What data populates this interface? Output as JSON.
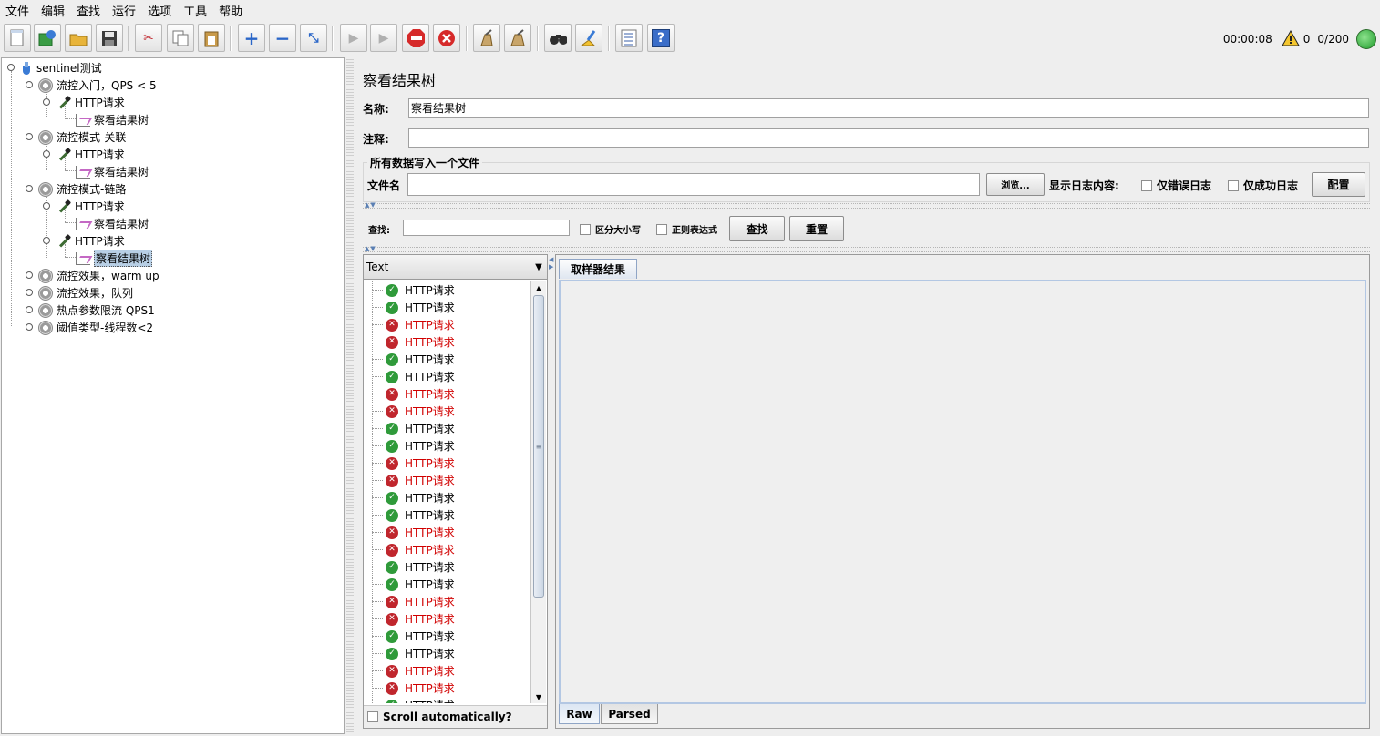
{
  "menu": [
    "文件",
    "编辑",
    "查找",
    "运行",
    "选项",
    "工具",
    "帮助"
  ],
  "toolbar_icons": [
    "new-icon",
    "templates-icon",
    "open-icon",
    "save-icon",
    "cut-icon",
    "copy-icon",
    "paste-icon",
    "expand-icon",
    "collapse-icon",
    "toggle-icon",
    "start-icon",
    "start-no-pause-icon",
    "stop-icon",
    "shutdown-icon",
    "clear-icon",
    "clear-all-icon",
    "search-icon",
    "reset-search-icon",
    "function-helper-icon",
    "help-icon"
  ],
  "status": {
    "timer": "00:00:08",
    "warnings": "0",
    "threads": "0/200"
  },
  "tree": {
    "root": "sentinel测试",
    "groups": [
      {
        "label": "流控入门，QPS < 5",
        "http": "HTTP请求",
        "listener": "察看结果树"
      },
      {
        "label": "流控模式-关联",
        "http": "HTTP请求",
        "listener": "察看结果树"
      },
      {
        "label": "流控模式-链路",
        "http": "HTTP请求",
        "listener": "察看结果树",
        "http2": "HTTP请求",
        "listener2": "察看结果树"
      },
      {
        "label": "流控效果，warm up"
      },
      {
        "label": "流控效果，队列"
      },
      {
        "label": "热点参数限流 QPS1"
      },
      {
        "label": "阈值类型-线程数<2"
      }
    ]
  },
  "panel": {
    "title": "察看结果树",
    "name_label": "名称:",
    "name_value": "察看结果树",
    "comment_label": "注释:",
    "comment_value": "",
    "file_group": "所有数据写入一个文件",
    "filename_label": "文件名",
    "filename_value": "",
    "browse": "浏览...",
    "log_label": "显示日志内容:",
    "errors_only": "仅错误日志",
    "success_only": "仅成功日志",
    "configure": "配置",
    "search_label": "查找:",
    "search_value": "",
    "case_sensitive": "区分大小写",
    "regex": "正则表达式",
    "find": "查找",
    "reset": "重置"
  },
  "renderer": "Text",
  "scroll_auto": "Scroll automatically?",
  "samples": [
    {
      "label": "HTTP请求",
      "ok": true
    },
    {
      "label": "HTTP请求",
      "ok": true
    },
    {
      "label": "HTTP请求",
      "ok": false
    },
    {
      "label": "HTTP请求",
      "ok": false
    },
    {
      "label": "HTTP请求",
      "ok": true
    },
    {
      "label": "HTTP请求",
      "ok": true
    },
    {
      "label": "HTTP请求",
      "ok": false
    },
    {
      "label": "HTTP请求",
      "ok": false
    },
    {
      "label": "HTTP请求",
      "ok": true
    },
    {
      "label": "HTTP请求",
      "ok": true
    },
    {
      "label": "HTTP请求",
      "ok": false
    },
    {
      "label": "HTTP请求",
      "ok": false
    },
    {
      "label": "HTTP请求",
      "ok": true
    },
    {
      "label": "HTTP请求",
      "ok": true
    },
    {
      "label": "HTTP请求",
      "ok": false
    },
    {
      "label": "HTTP请求",
      "ok": false
    },
    {
      "label": "HTTP请求",
      "ok": true
    },
    {
      "label": "HTTP请求",
      "ok": true
    },
    {
      "label": "HTTP请求",
      "ok": false
    },
    {
      "label": "HTTP请求",
      "ok": false
    },
    {
      "label": "HTTP请求",
      "ok": true
    },
    {
      "label": "HTTP请求",
      "ok": true
    },
    {
      "label": "HTTP请求",
      "ok": false
    },
    {
      "label": "HTTP请求",
      "ok": false
    },
    {
      "label": "HTTP请求",
      "ok": true
    }
  ],
  "result_tab": "取样器结果",
  "bottom_tabs": [
    "Raw",
    "Parsed"
  ],
  "colors": {
    "ok": "#2f9a3a",
    "fail": "#c0262d",
    "fail_text": "#d10000",
    "selection": "#b8cfe5"
  }
}
